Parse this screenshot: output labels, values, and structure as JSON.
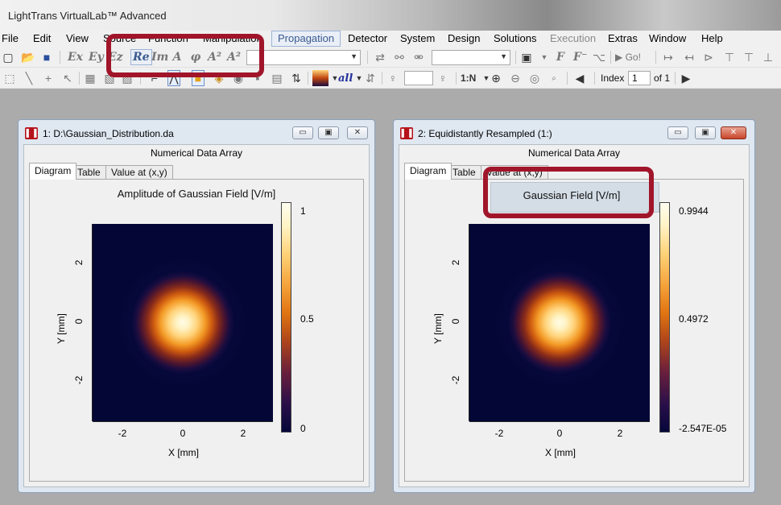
{
  "app": {
    "title": "LightTrans VirtualLab™ Advanced"
  },
  "menu": {
    "items": [
      {
        "label": "File",
        "state": "normal"
      },
      {
        "label": "Edit",
        "state": "normal"
      },
      {
        "label": "View",
        "state": "normal"
      },
      {
        "label": "Source",
        "state": "normal"
      },
      {
        "label": "Function",
        "state": "normal"
      },
      {
        "label": "Manipulation",
        "state": "normal"
      },
      {
        "label": "Propagation",
        "state": "highlight"
      },
      {
        "label": "Detector",
        "state": "normal"
      },
      {
        "label": "System",
        "state": "normal"
      },
      {
        "label": "Design",
        "state": "normal"
      },
      {
        "label": "Solutions",
        "state": "normal"
      },
      {
        "label": "Execution",
        "state": "disabled"
      },
      {
        "label": "Extras",
        "state": "normal"
      },
      {
        "label": "Window",
        "state": "normal"
      },
      {
        "label": "Help",
        "state": "normal"
      }
    ]
  },
  "toolbar1": {
    "field_buttons": [
      "Ex",
      "Ey",
      "Ez"
    ],
    "mode_buttons": [
      "Re",
      "Im",
      "A",
      "φ",
      "A²",
      "A²"
    ],
    "go_label": "▶ Go!"
  },
  "toolbar2": {
    "color_dropdown": "all",
    "index_label": "Index",
    "index_value": "1",
    "index_of": "of 1",
    "page_label": "1:N"
  },
  "windows": [
    {
      "title": "1: D:\\Gaussian_Distribution.da",
      "subtitle": "Numerical Data Array",
      "tabs": [
        "Diagram",
        "Table",
        "Value at (x,y)"
      ],
      "plot_title": "Amplitude of Gaussian Field  [V/m]",
      "x_label": "X [mm]",
      "y_label": "Y [mm]",
      "x_ticks": [
        "-2",
        "0",
        "2"
      ],
      "y_ticks": [
        "2",
        "0",
        "-2"
      ],
      "colorbar_labels": [
        "1",
        "0.5",
        "0"
      ]
    },
    {
      "title": "2: Equidistantly Resampled (1:)",
      "subtitle": "Numerical Data Array",
      "tabs": [
        "Diagram",
        "Table",
        "Value at (x,y)"
      ],
      "plot_title": "Gaussian Field  [V/m]",
      "x_label": "X [mm]",
      "y_label": "Y [mm]",
      "x_ticks": [
        "-2",
        "0",
        "2"
      ],
      "y_ticks": [
        "2",
        "0",
        "-2"
      ],
      "colorbar_labels": [
        "0.9944",
        "0.4972",
        "-2.547E-05"
      ]
    }
  ],
  "colors": {
    "annotation_box": "#a1152a",
    "workspace": "#ababab",
    "window_frame": "#dfe7f1"
  }
}
